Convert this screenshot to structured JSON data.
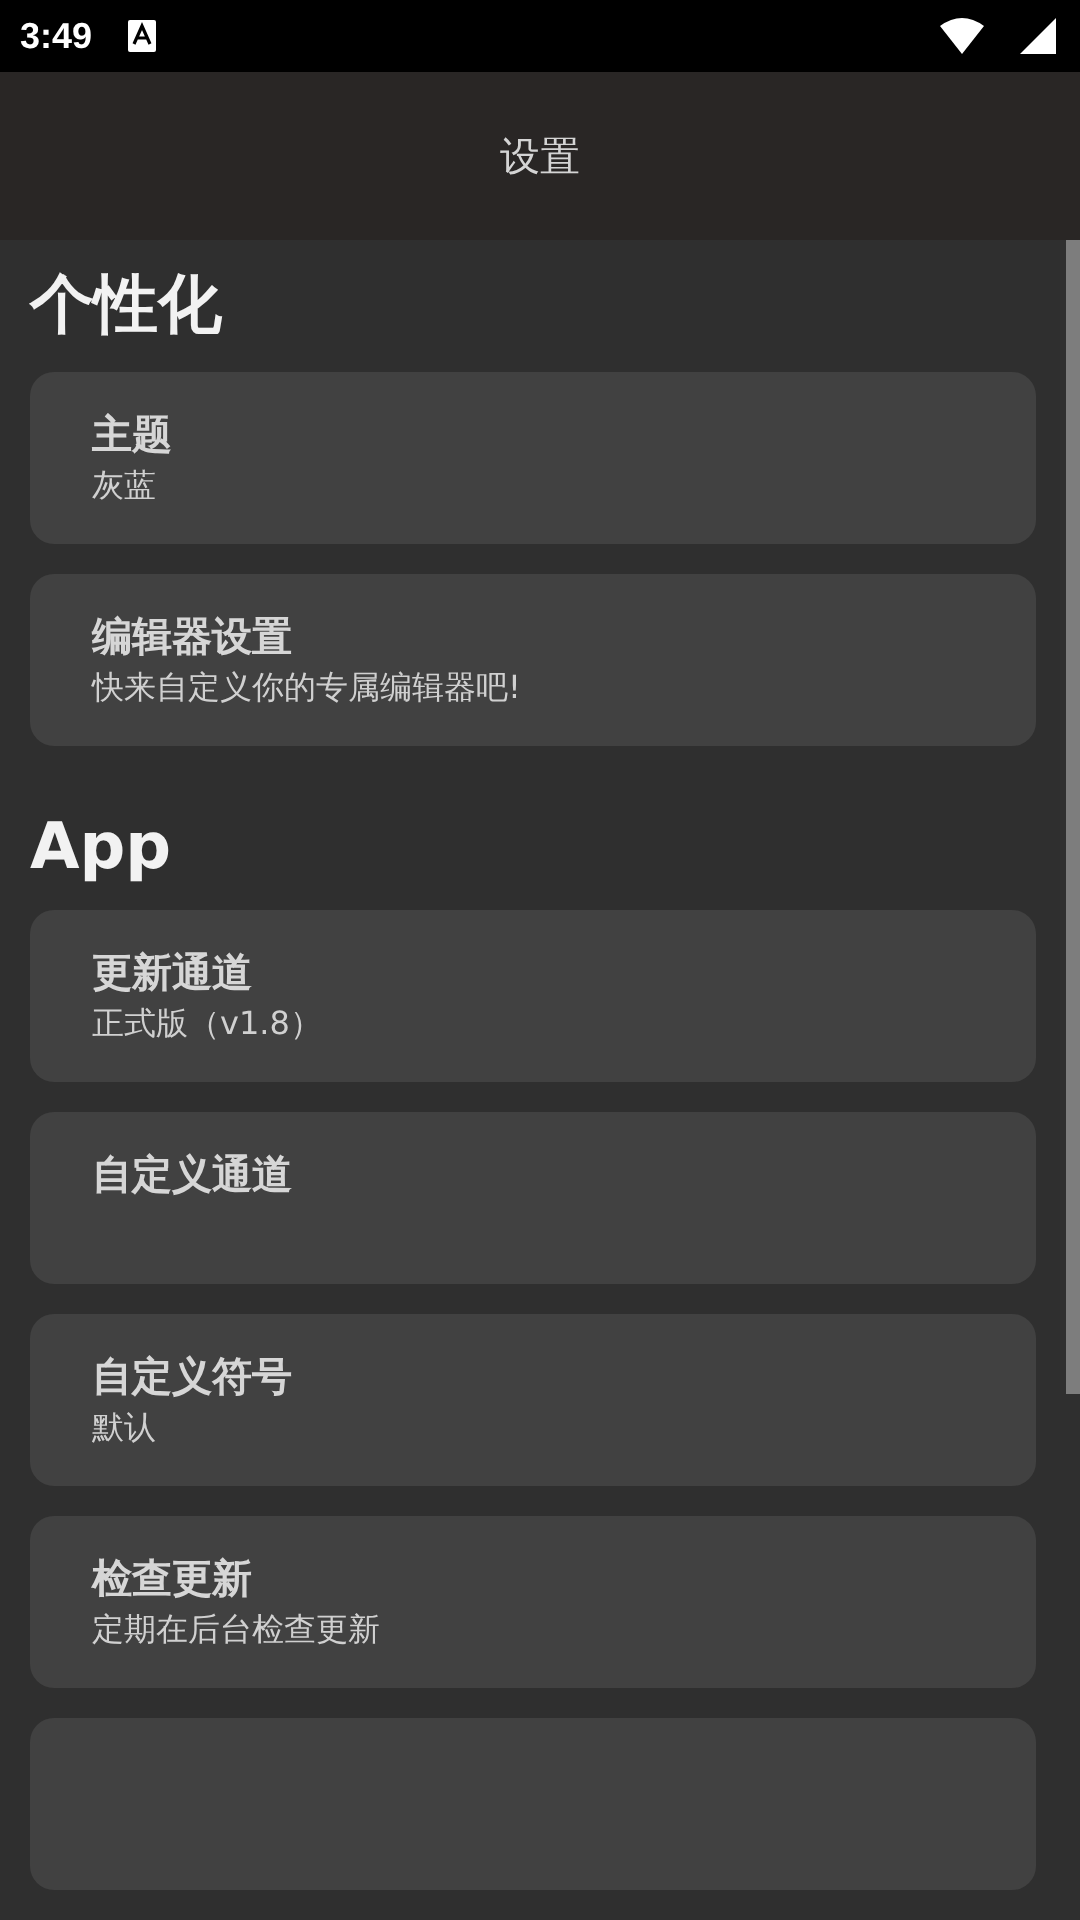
{
  "status_bar": {
    "time": "3:49"
  },
  "app_bar": {
    "title": "设置"
  },
  "sections": [
    {
      "heading": "个性化",
      "items": [
        {
          "title": "主题",
          "subtitle": "灰蓝"
        },
        {
          "title": "编辑器设置",
          "subtitle": "快来自定义你的专属编辑器吧!"
        }
      ]
    },
    {
      "heading": "App",
      "items": [
        {
          "title": "更新通道",
          "subtitle": "正式版（v1.8）"
        },
        {
          "title": "自定义通道"
        },
        {
          "title": "自定义符号",
          "subtitle": "默认"
        },
        {
          "title": "检查更新",
          "subtitle": "定期在后台检查更新"
        }
      ]
    }
  ]
}
